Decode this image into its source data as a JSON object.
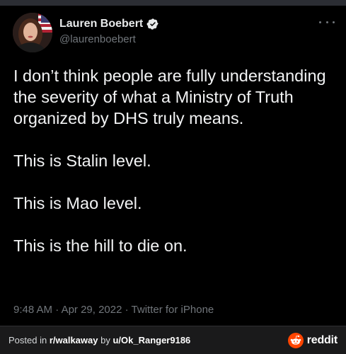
{
  "tweet": {
    "display_name": "Lauren Boebert",
    "handle": "@laurenboebert",
    "verified": true,
    "paragraphs": [
      "I don’t think people are fully understanding the severity of what a Ministry of Truth organized by DHS truly means.",
      "This is Stalin level.",
      "This is Mao level.",
      "This is the hill to die on."
    ],
    "time": "9:48 AM",
    "date": "Apr 29, 2022",
    "source": "Twitter for iPhone",
    "separator": " · "
  },
  "footer": {
    "posted_in_prefix": "Posted in ",
    "subreddit": "r/walkaway",
    "by_text": " by ",
    "username": "u/Ok_Ranger9186",
    "brand": "reddit"
  },
  "colors": {
    "background": "#000000",
    "text_primary": "#e7e9ea",
    "text_secondary": "#71767b",
    "verified_blue": "#1d9bf0",
    "reddit_orange": "#ff4500",
    "footer_bg": "#1a1a1b"
  },
  "icons": {
    "verified": "verified-badge-icon",
    "more": "more-options-icon",
    "reddit_logo": "reddit-snoo-icon"
  }
}
